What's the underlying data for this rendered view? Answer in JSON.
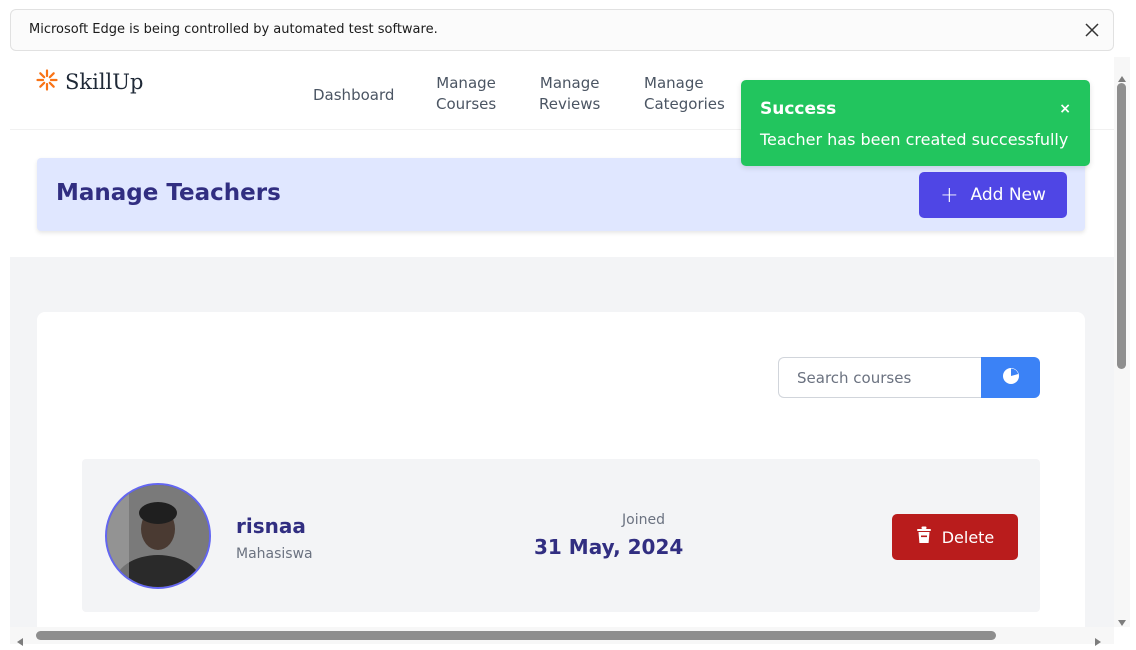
{
  "browser": {
    "infobar_text": "Microsoft Edge is being controlled by automated test software."
  },
  "brand": {
    "name": "SkillUp",
    "accent": "#f97316"
  },
  "nav": {
    "dashboard": "Dashboard",
    "courses": [
      "Manage",
      "Courses"
    ],
    "reviews": [
      "Manage",
      "Reviews"
    ],
    "categories": [
      "Manage",
      "Categories"
    ]
  },
  "page": {
    "title": "Manage Teachers",
    "add_button": "Add New"
  },
  "search": {
    "placeholder": "Search courses"
  },
  "teachers": [
    {
      "name": "risnaa",
      "role": "Mahasiswa",
      "joined_label": "Joined",
      "joined_date": "31 May, 2024",
      "delete_label": "Delete"
    }
  ],
  "toast": {
    "title": "Success",
    "message": "Teacher has been created successfully",
    "close": "×"
  },
  "colors": {
    "primary": "#4f46e5",
    "success": "#22c55e",
    "danger": "#b91c1c",
    "search": "#3b82f6",
    "title": "#312e81"
  },
  "icons": {
    "logo": "sun-burst-icon",
    "add": "plus-icon",
    "search": "search-icon",
    "delete": "trash-icon",
    "close": "close-icon"
  }
}
